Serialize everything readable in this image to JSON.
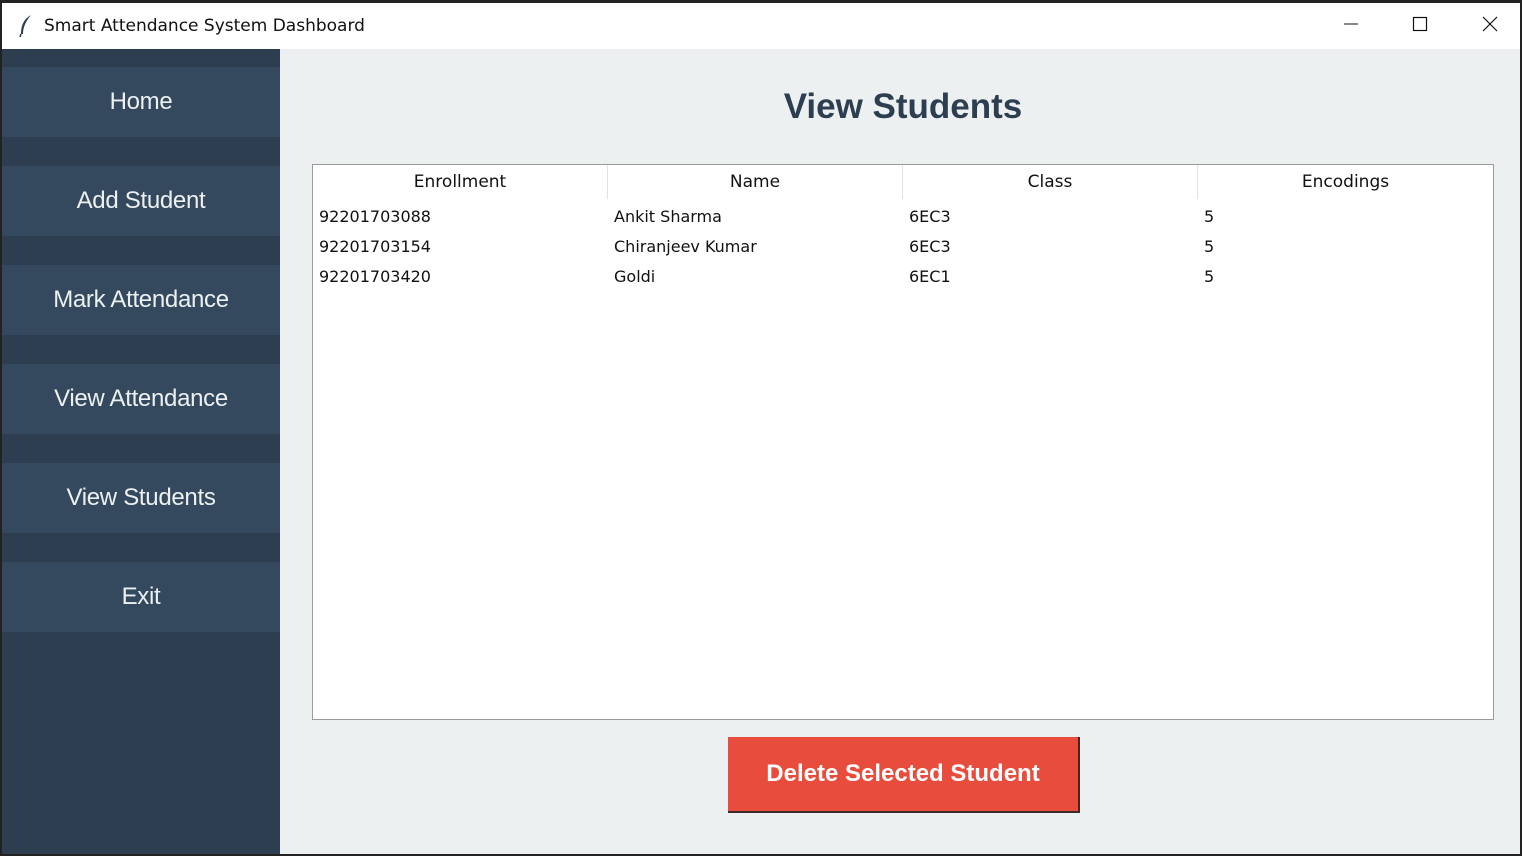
{
  "window": {
    "title": "Smart Attendance System Dashboard",
    "icon": "feather-icon",
    "controls": [
      "minimize-icon",
      "maximize-icon",
      "close-icon"
    ]
  },
  "sidebar": {
    "items": [
      {
        "label": "Home"
      },
      {
        "label": "Add Student"
      },
      {
        "label": "Mark Attendance"
      },
      {
        "label": "View Attendance"
      },
      {
        "label": "View Students"
      },
      {
        "label": "Exit"
      }
    ]
  },
  "main": {
    "title": "View Students",
    "table": {
      "columns": [
        "Enrollment",
        "Name",
        "Class",
        "Encodings"
      ],
      "rows": [
        [
          "92201703088",
          "Ankit Sharma",
          "6EC3",
          "5"
        ],
        [
          "92201703154",
          "Chiranjeev Kumar",
          "6EC3",
          "5"
        ],
        [
          "92201703420",
          "Goldi",
          "6EC1",
          "5"
        ]
      ]
    },
    "delete_button_label": "Delete Selected Student"
  },
  "colors": {
    "sidebar_bg": "#2c3e50",
    "sidebar_button": "#34495e",
    "main_bg": "#ecf0f1",
    "title_text": "#2c3e50",
    "danger": "#e74c3c"
  }
}
